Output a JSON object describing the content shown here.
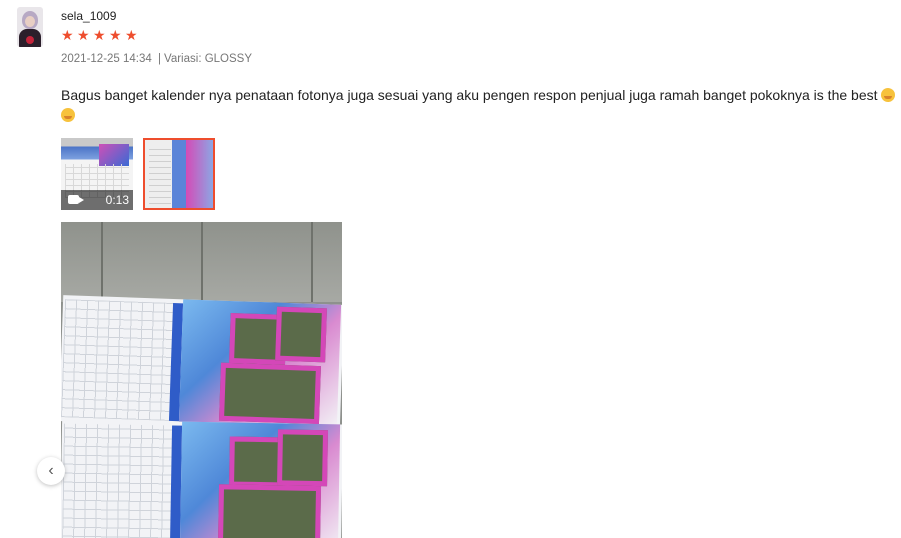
{
  "review": {
    "username": "sela_1009",
    "rating": 5,
    "date": "2021-12-25 14:34",
    "separator": "|",
    "variation": "Variasi: GLOSSY",
    "text": "Bagus banget kalender nya penataan fotonya juga sesuai yang aku pengen respon penjual juga ramah banget pokoknya is the best",
    "emojis": [
      "face-blowing-kiss-emoji",
      "hugging-face-emoji"
    ]
  },
  "media": {
    "video_thumb": {
      "duration": "0:13",
      "icon": "video-camera-icon"
    },
    "selected_index": 1,
    "count": 2
  },
  "colors": {
    "star": "#ee4d2d",
    "selected_border": "#ee4d2d",
    "meta_text": "#777777"
  },
  "nav": {
    "prev_icon": "chevron-left-icon",
    "prev_label": "‹"
  }
}
